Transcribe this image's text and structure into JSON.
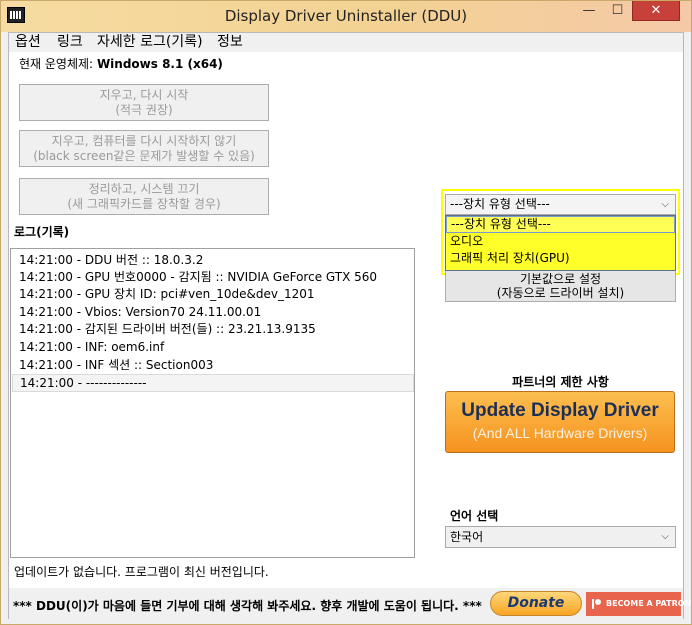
{
  "window": {
    "title": "Display Driver Uninstaller (DDU)",
    "min_glyph": "—",
    "max_glyph": "☐",
    "close_glyph": "✕"
  },
  "menu": [
    "옵션",
    "링크",
    "자세한 로그(기록)",
    "정보"
  ],
  "os": {
    "label": "현재 운영체제:",
    "value": "Windows 8.1 (x64)"
  },
  "actions": [
    {
      "line1": "지우고, 다시 시작",
      "line2": "(적극 권장)"
    },
    {
      "line1": "지우고, 컴퓨터를 다시 시작하지 않기",
      "line2": "(black screen같은 문제가 발생할 수 있음)"
    },
    {
      "line1": "정리하고, 시스템 끄기",
      "line2": "(새 그래픽카드를 장착할 경우)"
    }
  ],
  "log": {
    "label": "로그(기록)",
    "lines": [
      "14:21:00 - DDU 버전 :: 18.0.3.2",
      "14:21:00 - GPU 번호0000 - 감지됨 :: NVIDIA GeForce GTX 560",
      "14:21:00 - GPU 장치 ID: pci#ven_10de&dev_1201",
      "14:21:00 - Vbios: Version70 24.11.00.01",
      "14:21:00 - 감지된 드라이버 버전(들) :: 23.21.13.9135",
      "14:21:00 - INF: oem6.inf",
      "14:21:00 - INF 섹션 :: Section003",
      "14:21:00 - --------------"
    ]
  },
  "status": "업데이트가 없습니다. 프로그램이 최신 버전입니다.",
  "device_type": {
    "selected": "---장치 유형 선택---",
    "options": [
      "---장치 유형 선택---",
      "오디오",
      "그래픽 처리 장치(GPU)"
    ]
  },
  "default_button": {
    "line1": "기본값으로 설정",
    "line2": "(자동으로 드라이버 설치)"
  },
  "partner": {
    "label": "파트너의 제한 사항",
    "title": "Update Display Driver",
    "subtitle": "(And ALL Hardware Drivers)"
  },
  "language": {
    "label": "언어 선택",
    "selected": "한국어"
  },
  "footer": {
    "text": "*** DDU(이)가 마음에 들면 기부에 대해 생각해 봐주세요. 향후 개발에 도움이 됩니다. ***",
    "donate": "Donate",
    "patron": "BECOME A PATRON"
  },
  "colors": {
    "highlight": "#ffff00",
    "update_button": "#f6921f",
    "close_button": "#c7403a",
    "patron": "#e8644d"
  }
}
